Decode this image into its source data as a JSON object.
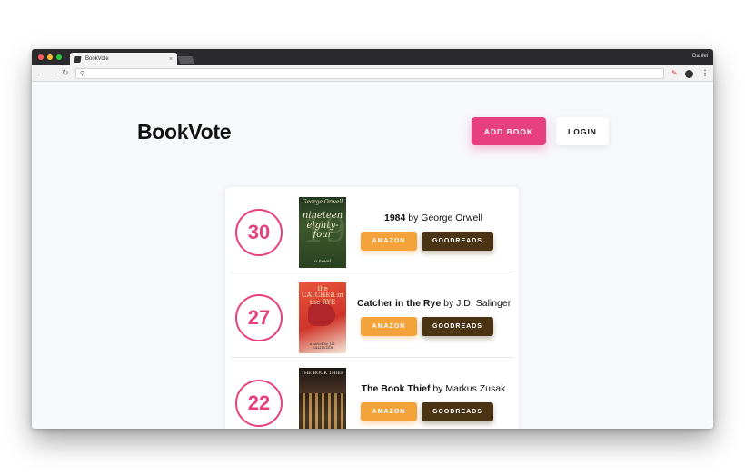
{
  "browser": {
    "tab_title": "BookVote",
    "user": "Daniel",
    "address": ""
  },
  "header": {
    "brand": "BookVote",
    "add_book_label": "ADD BOOK",
    "login_label": "LOGIN"
  },
  "books": [
    {
      "votes": "30",
      "title": "1984",
      "by": "by",
      "author": "George Orwell",
      "amazon_label": "AMAZON",
      "goodreads_label": "GOODREADS",
      "cover_text": {
        "author": "George Orwell",
        "title": "nineteen eighty-four",
        "subtitle": "a novel",
        "big": "1984"
      }
    },
    {
      "votes": "27",
      "title": "Catcher in the Rye",
      "by": "by",
      "author": "J.D. Salinger",
      "amazon_label": "AMAZON",
      "goodreads_label": "GOODREADS",
      "cover_text": {
        "title": "the CATCHER in the RYE",
        "author": "a novel by J.D. SALINGER"
      }
    },
    {
      "votes": "22",
      "title": "The Book Thief",
      "by": "by",
      "author": "Markus Zusak",
      "amazon_label": "AMAZON",
      "goodreads_label": "GOODREADS",
      "cover_text": {
        "title": "THE BOOK THIEF"
      }
    }
  ],
  "colors": {
    "accent_pink": "#e7407e",
    "amazon_orange": "#f4a23a",
    "goodreads_brown": "#4a3413"
  },
  "icons": [
    "back-arrow-icon",
    "forward-arrow-icon",
    "reload-icon",
    "search-icon",
    "pencil-icon",
    "chat-icon",
    "menu-icon",
    "book-tab-icon",
    "close-icon"
  ]
}
